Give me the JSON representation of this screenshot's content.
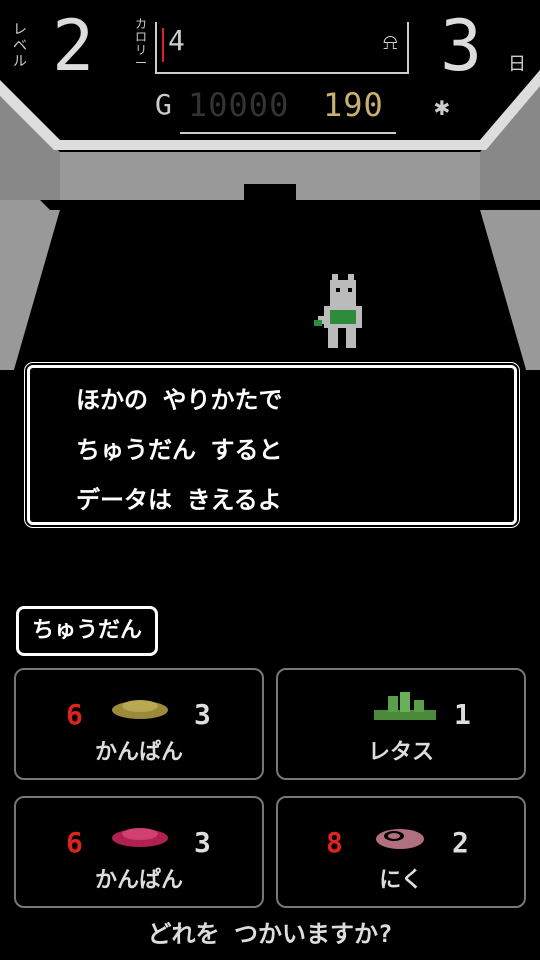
{
  "hud": {
    "level_label": "レベル",
    "level_value": "2",
    "calorie_label": "カロリー",
    "calorie_value": "4",
    "calorie_icon": "bottle-icon",
    "day_value": "3",
    "day_unit": "日",
    "gold_label": "G",
    "gold_zeros": "10000",
    "gold_value": "190",
    "weather_icon": "sun-icon",
    "colors": {
      "gold": "#c8b070",
      "calorie_marker": "#d22222"
    }
  },
  "dialog": {
    "lines": [
      "ほかの やりかたで",
      "ちゅうだん すると",
      "データは きえるよ"
    ]
  },
  "abort_button": {
    "label": "ちゅうだん"
  },
  "items": [
    {
      "name": "かんぱん",
      "left_qty": "6",
      "right_qty": "3",
      "left_color": "#d22222",
      "icon": "cracker-icon",
      "icon_color": "#9a8a3a"
    },
    {
      "name": "レタス",
      "left_qty": "",
      "right_qty": "1",
      "left_color": "#d22222",
      "icon": "lettuce-icon",
      "icon_color": "#4a8a3a"
    },
    {
      "name": "かんぱん",
      "left_qty": "6",
      "right_qty": "3",
      "left_color": "#d22222",
      "icon": "cracker-icon",
      "icon_color": "#b02050"
    },
    {
      "name": "にく",
      "left_qty": "8",
      "right_qty": "2",
      "left_color": "#d22222",
      "icon": "meat-icon",
      "icon_color": "#b07080"
    }
  ],
  "prompt": "どれを つかいますか?"
}
